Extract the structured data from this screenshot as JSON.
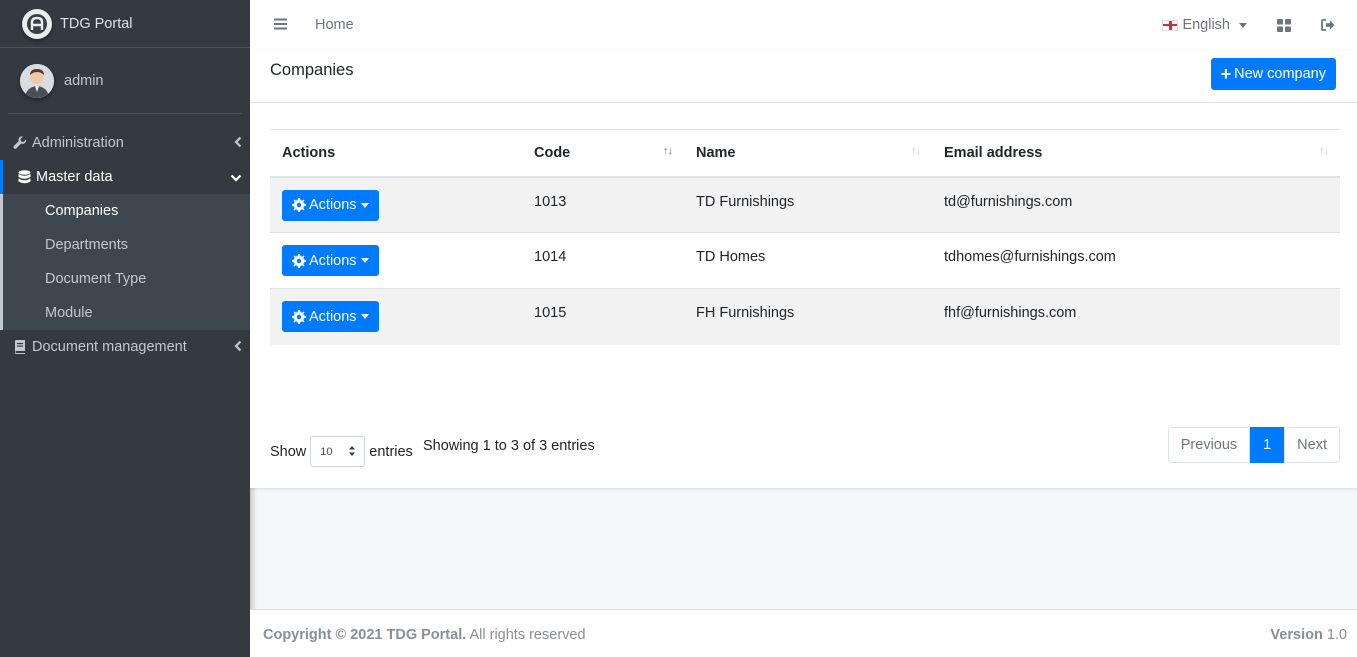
{
  "brand": {
    "name": "TDG Portal"
  },
  "user": {
    "name": "admin"
  },
  "sidebar": {
    "items": [
      {
        "label": "Administration",
        "icon": "wrench-icon"
      },
      {
        "label": "Master data",
        "icon": "database-icon",
        "children": [
          "Companies",
          "Departments",
          "Document Type",
          "Module"
        ]
      },
      {
        "label": "Document management",
        "icon": "book-icon"
      }
    ]
  },
  "topbar": {
    "home": "Home",
    "language": "English"
  },
  "page": {
    "title": "Companies",
    "new_button": "New company"
  },
  "table": {
    "columns": [
      "Actions",
      "Code",
      "Name",
      "Email address"
    ],
    "action_label": "Actions",
    "rows": [
      {
        "code": "1013",
        "name": "TD Furnishings",
        "email": "td@furnishings.com"
      },
      {
        "code": "1014",
        "name": "TD Homes",
        "email": "tdhomes@furnishings.com"
      },
      {
        "code": "1015",
        "name": "FH Furnishings",
        "email": "fhf@furnishings.com"
      }
    ]
  },
  "length_control": {
    "show": "Show",
    "value": "10",
    "entries": "entries"
  },
  "info": "Showing 1 to 3 of 3 entries",
  "pagination": {
    "previous": "Previous",
    "current": "1",
    "next": "Next"
  },
  "footer": {
    "copyright_bold": "Copyright © 2021 TDG Portal.",
    "copyright_rest": " All rights reserved",
    "version_label": "Version",
    "version_value": " 1.0"
  },
  "colors": {
    "primary": "#007bff",
    "sidebar": "#343a40"
  }
}
